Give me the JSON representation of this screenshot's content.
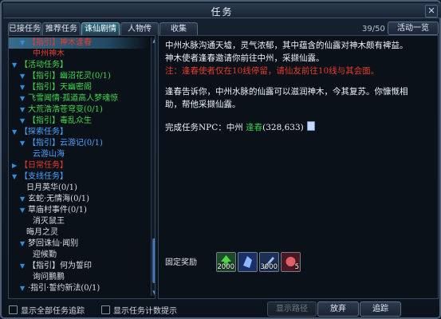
{
  "window": {
    "title": "任务",
    "close_glyph": "✕"
  },
  "tabs": [
    {
      "label": "已接任务",
      "active": false
    },
    {
      "label": "推荐任务",
      "active": false
    },
    {
      "label": "诛仙剧情",
      "active": true
    },
    {
      "label": "人物传",
      "active": false
    },
    {
      "label": "收集",
      "active": false
    }
  ],
  "progress": "39/50",
  "overview_button": "活动一览",
  "tree": [
    {
      "text": "【指引】神木逢春",
      "color": "#e83a2b",
      "indent": 14,
      "selected": true,
      "arrow": "▼"
    },
    {
      "text": "中州神木",
      "color": "#e83a2b",
      "indent": 30,
      "selected": false,
      "arrow": ""
    },
    {
      "text": "【活动任务】",
      "color": "#3fd94a",
      "indent": 4,
      "selected": false,
      "arrow": "▼"
    },
    {
      "text": "【指引】幽沼花灵(0/1)",
      "color": "#3fd94a",
      "indent": 14,
      "selected": false,
      "arrow": "▼"
    },
    {
      "text": "【指引】天幽密阁",
      "color": "#3fd94a",
      "indent": 14,
      "selected": false,
      "arrow": "▼"
    },
    {
      "text": "飞雪闻情·孤道高人梦魂惊",
      "color": "#3fd94a",
      "indent": 14,
      "selected": false,
      "arrow": "▼"
    },
    {
      "text": "大荒浩浩苍穹变(0/1)",
      "color": "#3fd94a",
      "indent": 14,
      "selected": false,
      "arrow": "▼"
    },
    {
      "text": "【指引】毒乱众生",
      "color": "#3fd94a",
      "indent": 14,
      "selected": false,
      "arrow": "▼"
    },
    {
      "text": "【探索任务】",
      "color": "#4aa3ff",
      "indent": 4,
      "selected": false,
      "arrow": "▼"
    },
    {
      "text": "【指引】云游记(0/1)",
      "color": "#4aa3ff",
      "indent": 14,
      "selected": false,
      "arrow": "▼"
    },
    {
      "text": "云游山海",
      "color": "#4aa3ff",
      "indent": 30,
      "selected": false,
      "arrow": ""
    },
    {
      "text": "【日常任务】",
      "color": "#e83a2b",
      "indent": 4,
      "selected": false,
      "arrow": "▶"
    },
    {
      "text": "【支线任务】",
      "color": "#4aa3ff",
      "indent": 4,
      "selected": false,
      "arrow": "▼"
    },
    {
      "text": "日月英华(0/1)",
      "color": "#d8dde6",
      "indent": 22,
      "selected": false,
      "arrow": ""
    },
    {
      "text": "玄蛇·无情海(0/1)",
      "color": "#d8dde6",
      "indent": 14,
      "selected": false,
      "arrow": "▼"
    },
    {
      "text": "草庙村事件(0/1)",
      "color": "#d8dde6",
      "indent": 14,
      "selected": false,
      "arrow": "▼"
    },
    {
      "text": "消灭鼠王",
      "color": "#d8dde6",
      "indent": 30,
      "selected": false,
      "arrow": ""
    },
    {
      "text": "晦月之灵",
      "color": "#d8dde6",
      "indent": 22,
      "selected": false,
      "arrow": ""
    },
    {
      "text": "梦回诛仙·闻别",
      "color": "#d8dde6",
      "indent": 14,
      "selected": false,
      "arrow": "▼"
    },
    {
      "text": "迎候勤",
      "color": "#d8dde6",
      "indent": 30,
      "selected": false,
      "arrow": ""
    },
    {
      "text": "【指引】何为誓印",
      "color": "#d8dde6",
      "indent": 14,
      "selected": false,
      "arrow": "▼"
    },
    {
      "text": "询问鹏鹏",
      "color": "#d8dde6",
      "indent": 30,
      "selected": false,
      "arrow": ""
    },
    {
      "text": "·指引·誓约新法(0/1)",
      "color": "#d8dde6",
      "indent": 14,
      "selected": false,
      "arrow": "▼"
    }
  ],
  "detail": {
    "line1": "中州水脉沟通天墟，灵气浓郁，其中蕴含的仙露对神木颇有裨益。",
    "line2": "神木使者逢春邀请你前往中州，采撷仙露。",
    "warning": "注：逢春使者仅在10线停留，请仙友前往10线与其会面。",
    "line3": "逢春告诉你，中州水脉的仙露可以滋润神木，今其复苏。你慷慨相",
    "line4": "助，帮他采撷仙露。",
    "npc_prefix": "完成任务NPC：中州 ",
    "npc_name": "逢春",
    "npc_coords": "(328,633)"
  },
  "rewards": {
    "label": "固定奖励",
    "items": [
      {
        "icon": "exp-arrow-icon",
        "qty": "2000",
        "bg": "#1e4a2a",
        "fg": "#4fd64a"
      },
      {
        "icon": "blue-crystal-icon",
        "qty": "",
        "bg": "#1a2f66",
        "fg": "#8fb6ff"
      },
      {
        "icon": "dagger-icon",
        "qty": "3000",
        "bg": "#1c2f55",
        "fg": "#a9c2ef"
      },
      {
        "icon": "spirit-orb-icon",
        "qty": "5",
        "bg": "#4a1820",
        "fg": "#e0606a"
      }
    ]
  },
  "bottom": {
    "show_all_label": "显示全部任务追踪",
    "show_timer_label": "显示任务计数提示",
    "route_button": "显示路径",
    "abandon_button": "放弃",
    "track_button": "追踪"
  }
}
